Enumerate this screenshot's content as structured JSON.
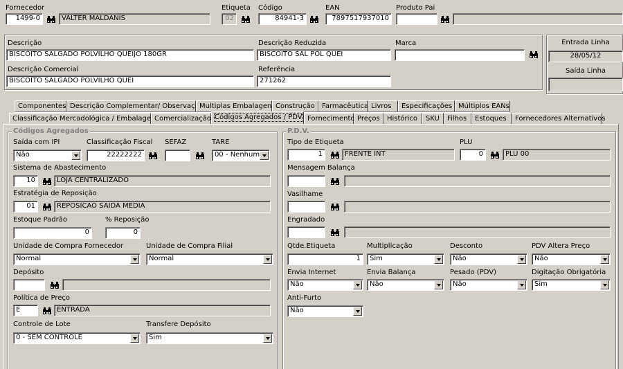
{
  "top": {
    "fornecedor_label": "Fornecedor",
    "fornecedor_code": "1499-0",
    "fornecedor_name": "VALTER MALDANIS",
    "etiqueta_label": "Etiqueta",
    "etiqueta_value": "02",
    "codigo_label": "Código",
    "codigo_value": "84941-3",
    "ean_label": "EAN",
    "ean_value": "7897517937010",
    "produto_pai_label": "Produto Pai",
    "produto_pai_value": "",
    "produto_pai_desc": ""
  },
  "desc": {
    "descricao_label": "Descrição",
    "descricao_value": "BISCOITO SALGADO POLVILHO QUEIJO 180GR",
    "desc_reduzida_label": "Descrição Reduzida",
    "desc_reduzida_value": "BISCOITO SAL POL QUEI",
    "marca_label": "Marca",
    "marca_value": "",
    "desc_comercial_label": "Descrição Comercial",
    "desc_comercial_value": "BISCOITO SALGADO POLVILHO QUEI",
    "referencia_label": "Referência",
    "referencia_value": "271262",
    "entrada_linha_label": "Entrada Linha",
    "entrada_linha_value": "28/05/12",
    "saida_linha_label": "Saída Linha",
    "saida_linha_value": ""
  },
  "tabs_row1": [
    "Componentes",
    "Descrição Complementar/ Observação",
    "Multiplas Embalagens",
    "Construção",
    "Farmacêutica",
    "Livros",
    "Especificações",
    "Múltiplos EANs"
  ],
  "tabs_row2": [
    "Classificação Mercadológica / Embalagens",
    "Comercialização",
    "Códigos Agregados / PDV",
    "Fornecimento",
    "Preços",
    "Histórico",
    "SKU",
    "Filhos",
    "Estoques",
    "Fornecedores Alternativos"
  ],
  "codigos": {
    "title": "Códigos Agregados",
    "saida_ipi_label": "Saída com IPI",
    "saida_ipi_value": "Não",
    "class_fiscal_label": "Classificação Fiscal",
    "class_fiscal_value": "22222222",
    "sefaz_label": "SEFAZ",
    "sefaz_value": "",
    "tare_label": "TARE",
    "tare_value": "00 - Nenhum",
    "sist_abast_label": "Sistema de Abastecimento",
    "sist_abast_code": "10",
    "sist_abast_desc": "LOJA CENTRALIZADO",
    "estrat_label": "Estratégia de Reposição",
    "estrat_code": "01",
    "estrat_desc": "REPOSICAO SAIDA MEDIA",
    "estoque_padrao_label": "Estoque Padrão",
    "estoque_padrao_value": "0",
    "perc_reposicao_label": "% Reposição",
    "perc_reposicao_value": "0",
    "un_compra_forn_label": "Unidade de Compra Fornecedor",
    "un_compra_forn_value": "Normal",
    "un_compra_filial_label": "Unidade de Compra Filial",
    "un_compra_filial_value": "Normal",
    "deposito_label": "Depósito",
    "deposito_code": "",
    "deposito_desc": "",
    "politica_label": "Política de Preço",
    "politica_code": "E",
    "politica_desc": "ENTRADA",
    "controle_lote_label": "Controle de Lote",
    "controle_lote_value": "0 - SEM CONTROLE",
    "transf_dep_label": "Transfere Depósito",
    "transf_dep_value": "Sim"
  },
  "pdv": {
    "title": "P.D.V.",
    "tipo_etiqueta_label": "Tipo de Etiqueta",
    "tipo_etiqueta_code": "1",
    "tipo_etiqueta_desc": "FRENTE INT",
    "plu_label": "PLU",
    "plu_code": "0",
    "plu_desc": "PLU 00",
    "msg_balanca_label": "Mensagem Balança",
    "vasilhame_label": "Vasilhame",
    "engradado_label": "Engradado",
    "qtde_etiqueta_label": "Qtde.Etiqueta",
    "qtde_etiqueta_value": "1",
    "multiplicacao_label": "Multiplicação",
    "multiplicacao_value": "Sim",
    "desconto_label": "Desconto",
    "desconto_value": "Não",
    "pdv_altera_label": "PDV Altera Preço",
    "pdv_altera_value": "Não",
    "envia_internet_label": "Envia Internet",
    "envia_internet_value": "Não",
    "envia_balanca_label": "Envia Balança",
    "envia_balanca_value": "Não",
    "pesado_label": "Pesado (PDV)",
    "pesado_value": "Não",
    "digitacao_label": "Digitação Obrigatória",
    "digitacao_value": "Sim",
    "antifurto_label": "Anti-Furto",
    "antifurto_value": "Não"
  }
}
